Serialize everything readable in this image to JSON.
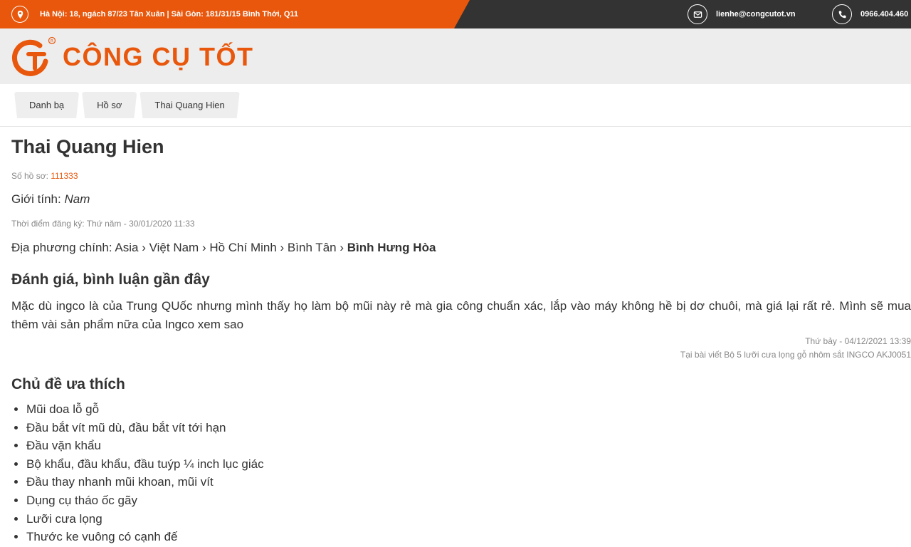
{
  "topbar": {
    "address": "Hà Nội: 18, ngách 87/23 Tân Xuân | Sài Gòn: 181/31/15 Bình Thới, Q11",
    "email": "lienhe@congcutot.vn",
    "phone": "0966.404.460"
  },
  "header": {
    "logo_text": "CÔNG CỤ TỐT"
  },
  "breadcrumb": [
    "Danh bạ",
    "Hồ sơ",
    "Thai Quang Hien"
  ],
  "profile": {
    "name": "Thai Quang Hien",
    "profile_no_label": "Số hồ sơ:",
    "profile_no": "111333",
    "gender_label": "Giới tính:",
    "gender": "Nam",
    "registered": "Thời điểm đăng ký: Thứ năm - 30/01/2020 11:33",
    "location_label": "Địa phương chính:",
    "location_path": [
      "Asia",
      "Việt Nam",
      "Hồ Chí Minh",
      "Bình Tân"
    ],
    "location_last": "Bình Hưng Hòa"
  },
  "reviews": {
    "title": "Đánh giá, bình luận gần đây",
    "items": [
      {
        "text": "Mặc dù ingco là của Trung QUốc nhưng mình thấy họ làm bộ mũi này rẻ mà gia công chuẩn xác, lắp vào máy không hề bị dơ chuôi, mà giá lại rất rẻ. Mình sẽ mua thêm vài sản phẩm nữa của Ingco xem sao",
        "date": "Thứ bảy - 04/12/2021 13:39",
        "article": "Tại bài viết Bộ 5 lưỡi cưa lọng gỗ nhôm sắt INGCO AKJ0051"
      }
    ]
  },
  "topics": {
    "title": "Chủ đề ưa thích",
    "items": [
      "Mũi doa lỗ gỗ",
      "Đầu bắt vít mũ dù, đầu bắt vít tới hạn",
      "Đầu vặn khẩu",
      "Bộ khẩu, đầu khẩu, đầu tuýp ¼ inch lục giác",
      "Đầu thay nhanh mũi khoan, mũi vít",
      "Dụng cụ tháo ốc gãy",
      "Lưỡi cưa lọng",
      "Thước ke vuông có cạnh đế"
    ]
  },
  "colors": {
    "brand_orange": "#e8570c",
    "topbar_dark": "#333333",
    "header_bg": "#ededed"
  },
  "icons": [
    "location-pin-icon",
    "envelope-icon",
    "phone-icon",
    "logo-mark-icon"
  ]
}
